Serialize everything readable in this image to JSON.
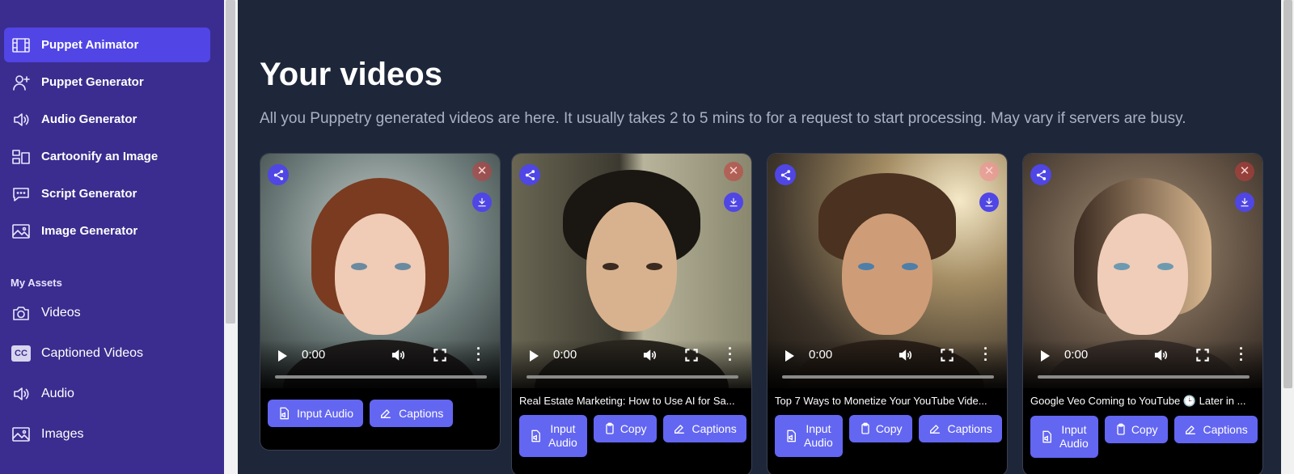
{
  "sidebar": {
    "items": [
      {
        "label": "Puppet Animator",
        "icon": "film-icon",
        "active": true
      },
      {
        "label": "Puppet Generator",
        "icon": "user-plus-icon"
      },
      {
        "label": "Audio Generator",
        "icon": "speaker-icon"
      },
      {
        "label": "Cartoonify an Image",
        "icon": "layout-icon"
      },
      {
        "label": "Script Generator",
        "icon": "chat-icon"
      },
      {
        "label": "Image Generator",
        "icon": "image-icon"
      }
    ],
    "assets_heading": "My Assets",
    "asset_items": [
      {
        "label": "Videos",
        "icon": "camera-icon"
      },
      {
        "label": "Captioned Videos",
        "icon": "cc-icon",
        "badge": "CC"
      },
      {
        "label": "Audio",
        "icon": "speaker-icon"
      },
      {
        "label": "Images",
        "icon": "image-icon"
      }
    ]
  },
  "main": {
    "title": "Your videos",
    "subtitle": "All you Puppetry generated videos are here. It usually takes 2 to 5 mins to for a request to start processing. May vary if servers are busy."
  },
  "cards": [
    {
      "time": "0:00",
      "title": "",
      "buttons": {
        "input_audio": "Input Audio",
        "captions": "Captions"
      }
    },
    {
      "time": "0:00",
      "title": "Real Estate Marketing: How to Use AI for Sa...",
      "buttons": {
        "input_audio_1": "Input",
        "input_audio_2": "Audio",
        "copy": "Copy",
        "captions": "Captions"
      }
    },
    {
      "time": "0:00",
      "title": "Top 7 Ways to Monetize Your YouTube Vide...",
      "buttons": {
        "input_audio_1": "Input",
        "input_audio_2": "Audio",
        "copy": "Copy",
        "captions": "Captions"
      }
    },
    {
      "time": "0:00",
      "title": "Google Veo Coming to YouTube 🕒 Later in ...",
      "buttons": {
        "input_audio_1": "Input",
        "input_audio_2": "Audio",
        "copy": "Copy",
        "captions": "Captions"
      }
    }
  ],
  "colors": {
    "sidebar_bg": "#3a2d8f",
    "active_item": "#5145e6",
    "main_bg": "#1e2639",
    "button": "#6363f1",
    "icon_badge": "#4f46e5"
  }
}
